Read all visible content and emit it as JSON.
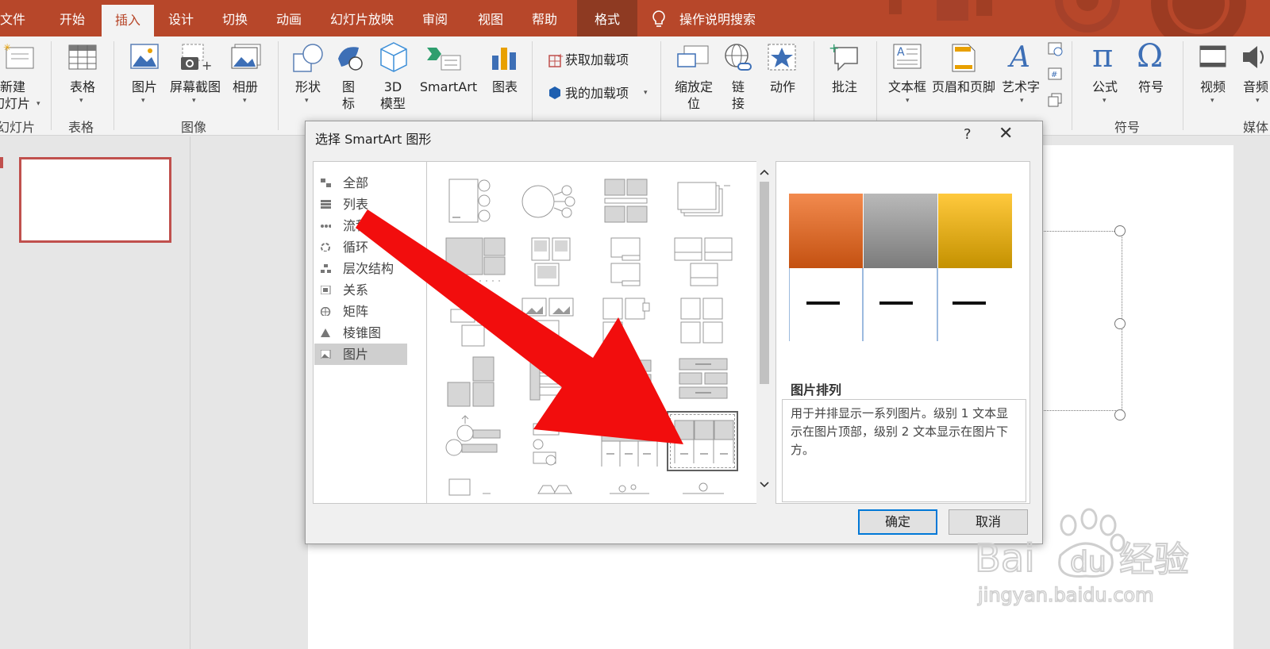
{
  "tabs": [
    "文件",
    "开始",
    "插入",
    "设计",
    "切换",
    "动画",
    "幻灯片放映",
    "审阅",
    "视图",
    "帮助",
    "格式"
  ],
  "tell_me": "操作说明搜索",
  "ribbon": {
    "new_slide": [
      "新建",
      "幻灯片"
    ],
    "table": "表格",
    "picture": "图片",
    "screenshot": "屏幕截图",
    "album": "相册",
    "shapes": "形状",
    "icons": [
      "图",
      "标"
    ],
    "model3d": [
      "3D",
      "模型"
    ],
    "smartart": "SmartArt",
    "chart": "图表",
    "get_addins": "获取加载项",
    "my_addins": "我的加载项",
    "zoom": [
      "缩放定",
      "位"
    ],
    "link": [
      "链",
      "接"
    ],
    "action": "动作",
    "comment": "批注",
    "textbox": "文本框",
    "header_footer": "页眉和页脚",
    "wordart": "艺术字",
    "equation": "公式",
    "symbol": "符号",
    "video": "视频",
    "audio": "音频"
  },
  "groups": {
    "slides": "幻灯片",
    "tables": "表格",
    "images": "图像",
    "symbols": "符号",
    "media": "媒体"
  },
  "dialog": {
    "title": "选择 SmartArt 图形",
    "help": "?",
    "close": "✕",
    "categories": [
      "全部",
      "列表",
      "流程",
      "循环",
      "层次结构",
      "关系",
      "矩阵",
      "棱锥图",
      "图片"
    ],
    "selected_category": "图片",
    "preview_name": "图片排列",
    "preview_desc": "用于并排显示一系列图片。级别 1 文本显示在图片顶部，级别 2 文本显示在图片下方。",
    "ok": "确定",
    "cancel": "取消"
  },
  "watermark": {
    "logo": "Bai du 经验",
    "url": "jingyan.baidu.com"
  },
  "colors": {
    "brand": "#b7472a",
    "arrow": "#f20d0d",
    "accent": "#0078d7"
  }
}
